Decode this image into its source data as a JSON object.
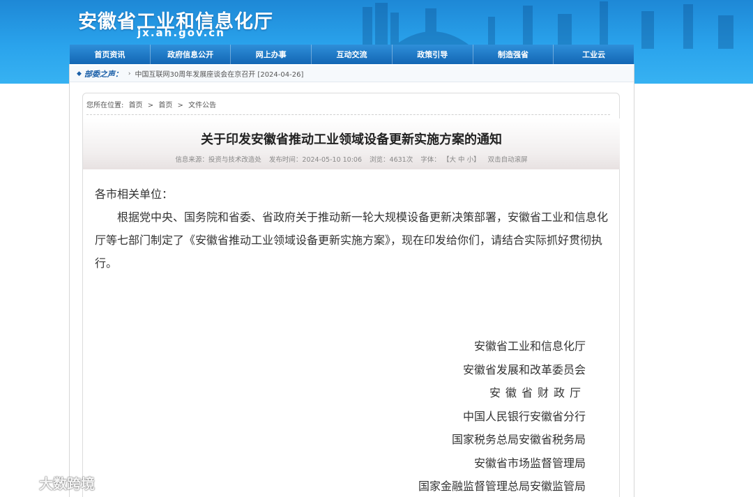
{
  "header": {
    "site_title": "安徽省工业和信息化厅",
    "site_domain": "jx.ah.gov.cn"
  },
  "nav": {
    "items": [
      "首页资讯",
      "政府信息公开",
      "网上办事",
      "互动交流",
      "政策引导",
      "制造强省",
      "工业云"
    ]
  },
  "notice": {
    "label": "部委之声：",
    "text": "中国互联网30周年发展座谈会在京召开 [2024-04-26]"
  },
  "breadcrumb": {
    "prefix": "您所在位置:",
    "items": [
      "首页",
      "首页",
      "文件公告"
    ],
    "separator": ">"
  },
  "article": {
    "title": "关于印发安徽省推动工业领域设备更新实施方案的通知",
    "meta": {
      "source": "信息来源：投资与技术改造处",
      "date": "发布时间：2024-05-10 10:06",
      "views": "浏览：4631次",
      "font_label": "字体：",
      "font_options": "【大 中 小】",
      "autoscroll": "双击自动滚屏"
    },
    "salutation": "各市相关单位：",
    "paragraph": "根据党中央、国务院和省委、省政府关于推动新一轮大规模设备更新决策部署，安徽省工业和信息化厅等七部门制定了《安徽省推动工业领域设备更新实施方案》，现在印发给你们，请结合实际抓好贯彻执行。",
    "signers": [
      "安徽省工业和信息化厅",
      "安徽省发展和改革委员会",
      "安徽省财政厅",
      "中国人民银行安徽省分行",
      "国家税务总局安徽省税务局",
      "安徽省市场监督管理局",
      "国家金融监督管理总局安徽监管局"
    ]
  },
  "watermark": {
    "text": "大数跨境"
  },
  "colors": {
    "header_blue": "#2aa3ec",
    "nav_blue": "#1366b4",
    "notice_label": "#1a5fa8"
  }
}
